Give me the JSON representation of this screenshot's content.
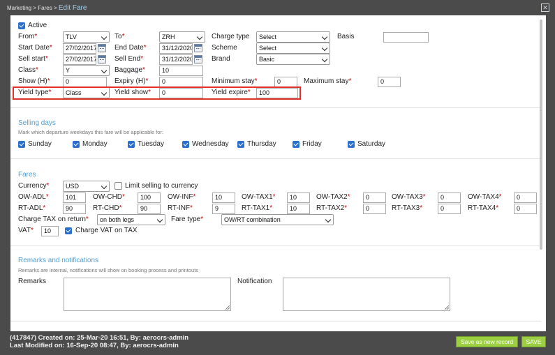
{
  "breadcrumb": {
    "part1": "Marketing",
    "sep": ">",
    "part2": "Fares",
    "current": "Edit Fare"
  },
  "close_label": "✕",
  "form": {
    "active_label": "Active",
    "from_label": "From",
    "from_value": "TLV",
    "to_label": "To",
    "to_value": "ZRH",
    "charge_type_label": "Charge type",
    "charge_type_value": "Select",
    "basis_label": "Basis",
    "basis_value": "",
    "start_date_label": "Start Date",
    "start_date_value": "27/02/2017",
    "end_date_label": "End Date",
    "end_date_value": "31/12/2020",
    "scheme_label": "Scheme",
    "scheme_value": "Select",
    "sell_start_label": "Sell start",
    "sell_start_value": "27/02/2017",
    "sell_end_label": "Sell End",
    "sell_end_value": "31/12/2020",
    "brand_label": "Brand",
    "brand_value": "Basic",
    "class_label": "Class",
    "class_value": "Y",
    "baggage_label": "Baggage",
    "baggage_value": "10",
    "show_label": "Show (H)",
    "show_value": "0",
    "expiry_label": "Expiry (H)",
    "expiry_value": "0",
    "min_stay_label": "Minimum stay",
    "min_stay_value": "0",
    "max_stay_label": "Maximum stay",
    "max_stay_value": "0",
    "yield_type_label": "Yield type",
    "yield_type_value": "Class",
    "yield_show_label": "Yield show",
    "yield_show_value": "0",
    "yield_expire_label": "Yield expire",
    "yield_expire_value": "100"
  },
  "selling_days": {
    "title": "Selling days",
    "note": "Mark which departure weekdays this fare will be applicable for:",
    "days": [
      "Sunday",
      "Monday",
      "Tuesday",
      "Wednesday",
      "Thursday",
      "Friday",
      "Saturday"
    ]
  },
  "fares": {
    "title": "Fares",
    "currency_label": "Currency",
    "currency_value": "USD",
    "limit_label": "Limit selling to currency",
    "ow_adl_label": "OW-ADL",
    "ow_adl_value": "101",
    "ow_chd_label": "OW-CHD",
    "ow_chd_value": "100",
    "ow_inf_label": "OW-INF",
    "ow_inf_value": "10",
    "ow_tax1_label": "OW-TAX1",
    "ow_tax1_value": "10",
    "ow_tax2_label": "OW-TAX2",
    "ow_tax2_value": "0",
    "ow_tax3_label": "OW-TAX3",
    "ow_tax3_value": "0",
    "ow_tax4_label": "OW-TAX4",
    "ow_tax4_value": "0",
    "rt_adl_label": "RT-ADL",
    "rt_adl_value": "90",
    "rt_chd_label": "RT-CHD",
    "rt_chd_value": "90",
    "rt_inf_label": "RT-INF",
    "rt_inf_value": "9",
    "rt_tax1_label": "RT-TAX1",
    "rt_tax1_value": "10",
    "rt_tax2_label": "RT-TAX2",
    "rt_tax2_value": "0",
    "rt_tax3_label": "RT-TAX3",
    "rt_tax3_value": "0",
    "rt_tax4_label": "RT-TAX4",
    "rt_tax4_value": "0",
    "charge_tax_label": "Charge TAX on return",
    "charge_tax_value": "on both legs",
    "fare_type_label": "Fare type",
    "fare_type_value": "OW/RT combination",
    "vat_label": "VAT",
    "vat_value": "10",
    "charge_vat_label": "Charge VAT on TAX"
  },
  "remarks": {
    "title": "Remarks and notifications",
    "note": "Remarks are internal, notifications will show on booking process and printouts",
    "remarks_label": "Remarks",
    "notification_label": "Notification"
  },
  "footer": {
    "created": "(417847) Created on: 25-Mar-20 16:51, By: aerocrs-admin",
    "modified": "Last Modified on: 16-Sep-20 08:47, By: aerocrs-admin",
    "save_new_label": "Save as new record",
    "save_label": "SAVE"
  },
  "colors": {
    "accent": "#4e9fd8",
    "button": "#9ccf42",
    "highlight": "#e0322a",
    "chrome": "#4b4b4b"
  }
}
